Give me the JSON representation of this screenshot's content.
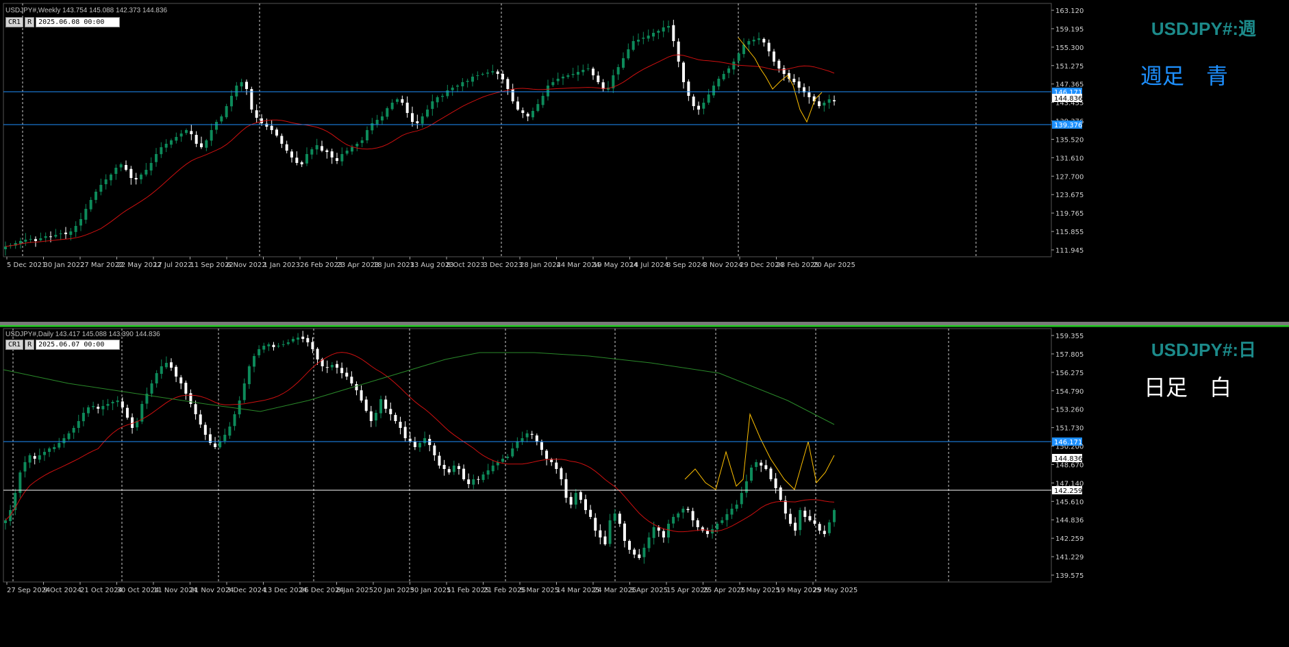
{
  "weekly": {
    "header": "USDJPY#,Weekly  143.754 145.088 142.373 144.836",
    "cr_label": "CR1",
    "r_label": "R",
    "datetime": "2025.06.08 00:00",
    "title": "USDJPY#:週",
    "note": "週足　青",
    "note_color": "#1e90ff",
    "y_ticks": [
      "163.120",
      "159.195",
      "155.300",
      "151.275",
      "147.365",
      "143.455",
      "139.376",
      "135.520",
      "131.610",
      "127.700",
      "123.675",
      "119.765",
      "115.855",
      "111.945"
    ],
    "x_ticks": [
      "5 Dec 2021",
      "30 Jan 2022",
      "27 Mar 2022",
      "22 May 2022",
      "17 Jul 2022",
      "11 Sep 2022",
      "6 Nov 2022",
      "1 Jan 2023",
      "26 Feb 2023",
      "23 Apr 2023",
      "18 Jun 2023",
      "13 Aug 2023",
      "8 Oct 2023",
      "3 Dec 2023",
      "28 Jan 2024",
      "24 Mar 2024",
      "19 May 2024",
      "14 Jul 2024",
      "8 Sep 2024",
      "3 Nov 2024",
      "29 Dec 2024",
      "23 Feb 2025",
      "20 Apr 2025"
    ],
    "price_markers": [
      {
        "label": "146.171",
        "color": "#1e90ff"
      },
      {
        "label": "144.836",
        "color": "#ffffff"
      },
      {
        "label": "139.376",
        "color": "#1e90ff"
      }
    ]
  },
  "daily": {
    "header": "USDJPY#,Daily  143.417 145.088 143.390 144.836",
    "cr_label": "CR1",
    "r_label": "R",
    "datetime": "2025.06.07 00:00",
    "title": "USDJPY#:日",
    "note": "日足　白",
    "note_color": "#ffffff",
    "y_ticks": [
      "159.355",
      "157.805",
      "156.275",
      "154.790",
      "153.260",
      "151.730",
      "150.200",
      "148.670",
      "147.140",
      "145.610",
      "144.836",
      "142.259",
      "141.229",
      "139.575"
    ],
    "x_ticks": [
      "27 Sep 2024",
      "9 Oct 2024",
      "21 Oct 2024",
      "30 Oct 2024",
      "11 Nov 2024",
      "21 Nov 2024",
      "3 Dec 2024",
      "13 Dec 2024",
      "26 Dec 2024",
      "8 Jan 2025",
      "20 Jan 2025",
      "30 Jan 2025",
      "11 Feb 2025",
      "21 Feb 2025",
      "5 Mar 2025",
      "14 Mar 2025",
      "24 Mar 2025",
      "3 Apr 2025",
      "15 Apr 2025",
      "25 Apr 2025",
      "7 May 2025",
      "19 May 2025",
      "29 May 2025"
    ],
    "price_markers": [
      {
        "label": "146.171",
        "color": "#1e90ff"
      },
      {
        "label": "144.836",
        "color": "#ffffff"
      },
      {
        "label": "142.259",
        "color": "#ffffff"
      }
    ]
  },
  "colors": {
    "bull": "#0d8a5a",
    "bear": "#ffffff",
    "ma_red": "#d01010",
    "ma_green": "#2a8a2a",
    "hline_blue": "#1e90ff",
    "zigzag": "#ffc000"
  }
}
